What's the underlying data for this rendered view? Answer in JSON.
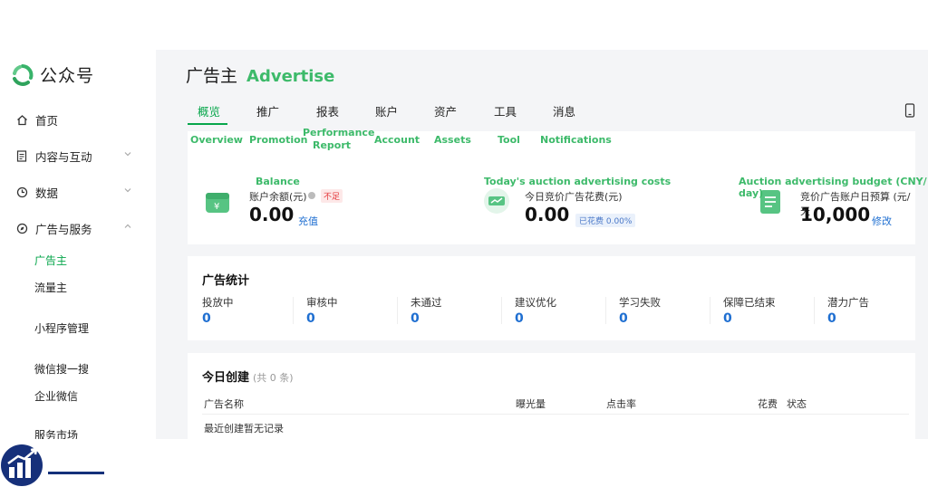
{
  "brand": {
    "name": "公众号"
  },
  "sidebar": {
    "items": [
      {
        "label": "首页",
        "icon": "home-icon"
      },
      {
        "label": "内容与互动",
        "icon": "document-icon"
      },
      {
        "label": "数据",
        "icon": "clock-pie-icon"
      },
      {
        "label": "广告与服务",
        "icon": "compass-icon"
      }
    ],
    "sub_items": [
      "广告主",
      "流量主",
      "小程序管理",
      "微信搜一搜",
      "企业微信",
      "服务市场"
    ]
  },
  "header": {
    "title_cn": "广告主",
    "title_en": "Advertise"
  },
  "tabs": [
    {
      "label": "概览",
      "en": "Overview"
    },
    {
      "label": "推广",
      "en": "Promotion"
    },
    {
      "label": "报表",
      "en": "Performance Report"
    },
    {
      "label": "账户",
      "en": "Account"
    },
    {
      "label": "资产",
      "en": "Assets"
    },
    {
      "label": "工具",
      "en": "Tool"
    },
    {
      "label": "消息",
      "en": "Notifications"
    }
  ],
  "overview": {
    "balance": {
      "en": "Balance",
      "label": "账户余额(元)",
      "badge": "不足",
      "value": "0.00",
      "link": "充值"
    },
    "today_cost": {
      "en": "Today's auction advertising costs",
      "label": "今日竞价广告花费(元)",
      "value": "0.00",
      "badge": "已花费 0.00%"
    },
    "budget": {
      "en": "Auction advertising budget (CNY/ day)",
      "label": "竞价广告账户日预算 (元/天",
      "value": "10,000",
      "link": "修改"
    }
  },
  "stats": {
    "title": "广告统计",
    "items": [
      {
        "label": "投放中",
        "value": "0"
      },
      {
        "label": "审核中",
        "value": "0"
      },
      {
        "label": "未通过",
        "value": "0"
      },
      {
        "label": "建议优化",
        "value": "0"
      },
      {
        "label": "学习失败",
        "value": "0"
      },
      {
        "label": "保障已结束",
        "value": "0"
      },
      {
        "label": "潜力广告",
        "value": "0"
      }
    ]
  },
  "today": {
    "title": "今日创建",
    "count": "(共 0 条)",
    "columns": [
      "广告名称",
      "曝光量",
      "点击率",
      "花费",
      "状态"
    ],
    "empty": "最近创建暂无记录"
  },
  "colors": {
    "accent": "#07a64b",
    "link": "#1f6fd1",
    "highlight": "#3dba6a"
  }
}
